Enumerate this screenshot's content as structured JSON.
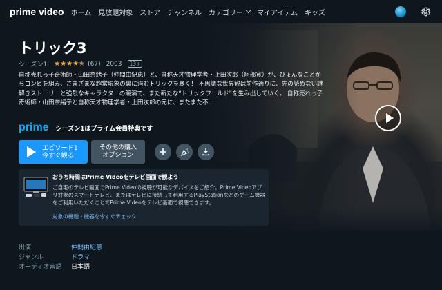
{
  "nav": {
    "logo": "prime video",
    "links": [
      "ホーム",
      "見放題対象",
      "ストア",
      "チャンネル",
      "カテゴリー",
      "マイアイテム",
      "キッズ"
    ],
    "avatar_icon": "user-avatar-icon",
    "settings_icon": "gear-icon"
  },
  "show": {
    "title": "トリック3",
    "season": "シーズン1",
    "rating_stars": 4.5,
    "review_count": "(67)",
    "year": "2003",
    "age_rating": "13+",
    "synopsis": "自称売れっ子奇術師・山田奈緒子（仲間由紀恵）と、自称天才物理学者・上田次郎（阿部寛）が、ひょんなことからコンビを組み、さまざまな超常現象の裏に潜むトリックを暴く！ 不思議な世界観は前作通りに、先の読めない謎解きストーリーと強烈なキャラクターの競演で、また新たな“トリックワールド”を生み出していく。 自称売れっ子奇術師・山田奈緒子と自称天才物理学者・上田次郎の元に、またまた不..."
  },
  "prime": {
    "brand": "prime",
    "tagline": "シーズン1はプライム会員特典です",
    "brand_color": "#1aa7ec"
  },
  "actions": {
    "play_line1": "エピソード1",
    "play_line2": "今すぐ観る",
    "more_line1": "その他の購入",
    "more_line2": "オプション",
    "add_icon": "plus-icon",
    "party_icon": "watch-party-icon",
    "download_icon": "download-icon",
    "play_color": "#1a98ff"
  },
  "info_box": {
    "title": "おうち時間はPrime Videoをテレビ画面で観よう",
    "text": "ご自宅のテレビ画面でPrime Videoの視聴が可能なデバイスをご紹介。Prime Videoアプリ対象のスマートテレビ、またはテレビに接続して利用するPlayStationなどのゲーム機器をご利用いただくことでPrime Videoをテレビ画面で視聴できます。",
    "link": "対象の機種・機器を今すぐチェック"
  },
  "details": [
    {
      "key": "出演",
      "value": "仲間由紀恵"
    },
    {
      "key": "ジャンル",
      "value": "ドラマ"
    },
    {
      "key": "オーディオ言語",
      "value": "日本語"
    }
  ]
}
